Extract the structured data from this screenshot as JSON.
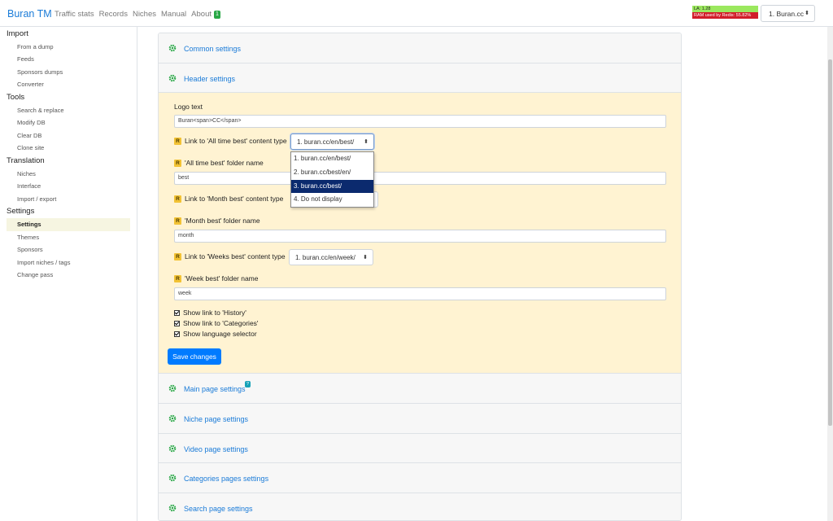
{
  "navbar": {
    "brand": "Buran TM",
    "links": [
      "Traffic stats",
      "Records",
      "Niches",
      "Manual"
    ],
    "about": "About",
    "about_badge": "1",
    "la": "LA: 1.28",
    "ram": "RAM used by Redis: 55.82%",
    "site_selected": "1. Buran.cc"
  },
  "sidebar": {
    "import": "Import",
    "import_items": [
      "From a dump",
      "Feeds",
      "Sponsors dumps",
      "Converter"
    ],
    "tools": "Tools",
    "tools_items": [
      "Search & replace",
      "Modify DB",
      "Clear DB",
      "Clone site"
    ],
    "translation": "Translation",
    "translation_items": [
      "Niches",
      "Interface",
      "Import / export"
    ],
    "settings": "Settings",
    "settings_items": [
      "Settings",
      "Themes",
      "Sponsors",
      "Import niches / tags",
      "Change pass"
    ]
  },
  "sections": {
    "common": "Common settings",
    "header": "Header settings",
    "main_page": "Main page settings",
    "main_page_badge": "?",
    "niche_page": "Niche page settings",
    "video_page": "Video page settings",
    "categories_pages": "Categories pages settings",
    "search_page": "Search page settings"
  },
  "form": {
    "logo_label": "Logo text",
    "logo_value": "Buran<span>CC</span>",
    "r": "R",
    "alltime_link_label": "Link to 'All time best' content type",
    "alltime_link_value": "1. buran.cc/en/best/",
    "alltime_folder_label": "'All time best' folder name",
    "alltime_folder_value": "best",
    "month_link_label": "Link to 'Month best' content type",
    "month_folder_label": "'Month best' folder name",
    "month_folder_value": "month",
    "weeks_link_label": "Link to 'Weeks best' content type",
    "weeks_link_value": "1. buran.cc/en/week/",
    "week_folder_label": "'Week best' folder name",
    "week_folder_value": "week",
    "dropdown_options": [
      "1. buran.cc/en/best/",
      "2. buran.cc/best/en/",
      "3. buran.cc/best/",
      "4. Do not display"
    ],
    "check_history": "Show link to 'History'",
    "check_categories": "Show link to 'Categories'",
    "check_language": "Show language selector",
    "save": "Save changes"
  },
  "colors": {
    "accent": "#007bff",
    "link": "#1a7bd8",
    "form_bg": "#fff3d2",
    "gear": "#28a745"
  }
}
